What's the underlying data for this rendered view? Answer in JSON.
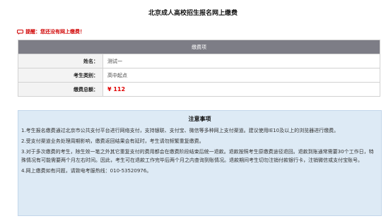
{
  "page": {
    "title": "北京成人高校招生报名网上缴费"
  },
  "reminder": {
    "text": "提醒：您还没有网上缴费！"
  },
  "fee": {
    "header": "缴费项",
    "rows": [
      {
        "label": "姓名：",
        "value": "测试一"
      },
      {
        "label": "考生类别：",
        "value": "高中起点"
      },
      {
        "label": "缴费总额：",
        "value": "¥ 112"
      }
    ]
  },
  "notice": {
    "title": "注意事项",
    "items": [
      "1.考生报名缴费通过北京市公共支付平台进行网络支付，支持银联、支付宝、微信等多种网上支付渠道。建议使用IE10及以上的浏览器进行缴费。",
      "2.受支付渠道业务处理周期影响，缴费返回结果会有延时，考生请勿频繁重复缴费。",
      "3.对于多次缴费的考生，除生效一笔之外其它重复支付的费用都会在缴费阶段结束后统一退款。退款按照考生原缴费途径退回。退款到账通常需要30个工作日，特殊情况有可能需要两个月左右时间。因此，考生可在退款工作完毕后两个月之内查询到账情况。退款期间考生切勿注销付款银行卡，注销微信或支付宝账号。",
      "4.网上缴费如有问题，请致电考服热线：010-53520976。"
    ]
  },
  "colors": {
    "header_bg": "#7d7d86",
    "notice_bg": "#ddeaf5",
    "alert": "#e00000"
  }
}
